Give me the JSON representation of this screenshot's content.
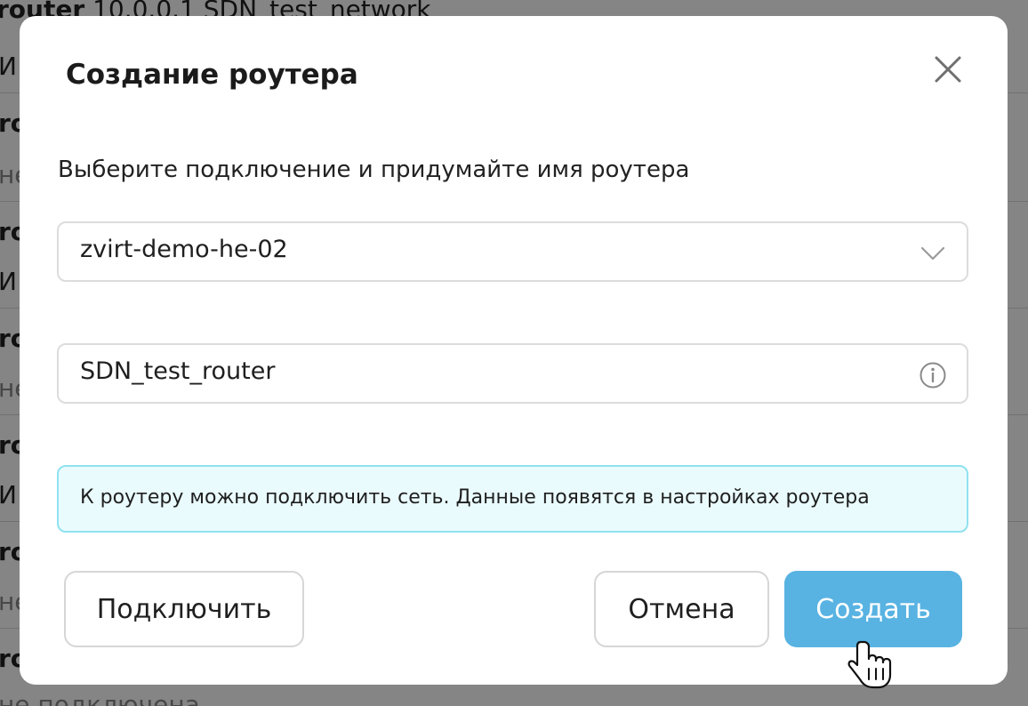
{
  "background": {
    "top_line": {
      "name": "router",
      "ip": "10.0.0.1",
      "network": "SDN_test_network"
    },
    "rows": [
      {
        "first": "ro",
        "second": "И"
      },
      {
        "first": "ro",
        "second": "не"
      },
      {
        "first": "ro",
        "second": "И"
      },
      {
        "first": "ro",
        "second": "не"
      },
      {
        "first": "ro",
        "second": "И"
      },
      {
        "first": "ro",
        "second": "не"
      },
      {
        "first": "ro",
        "second": "не подключена"
      }
    ]
  },
  "modal": {
    "title": "Создание роутера",
    "subtitle": "Выберите подключение и придумайте имя роутера",
    "connection_select": {
      "value": "zvirt-demo-he-02"
    },
    "router_name_input": {
      "value": "SDN_test_router"
    },
    "info_message": "К роутеру можно подключить сеть. Данные появятся в настройках роутера",
    "buttons": {
      "connect": "Подключить",
      "cancel": "Отмена",
      "create": "Создать"
    },
    "icons": {
      "close": "close-icon",
      "dropdown": "chevron-down-icon",
      "info": "info-icon",
      "cursor": "hand-pointer-icon"
    }
  },
  "colors": {
    "primary": "#58b3e2",
    "info_bg": "#eafbfd",
    "info_border": "#8fe2f0",
    "overlay": "rgba(0,0,0,0.48)"
  }
}
